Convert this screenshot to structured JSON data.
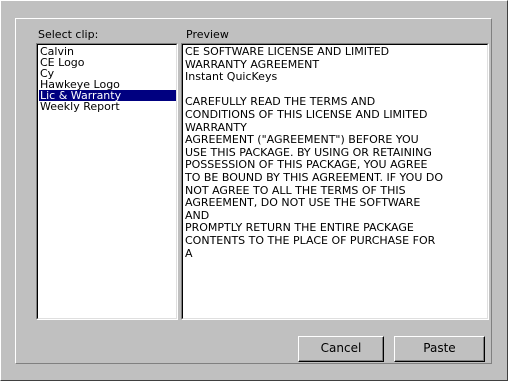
{
  "labels": {
    "select_clip": "Select clip:",
    "preview": "Preview"
  },
  "clips": {
    "items": [
      {
        "label": "Calvin"
      },
      {
        "label": "CE Logo"
      },
      {
        "label": "Cy"
      },
      {
        "label": "Hawkeye Logo"
      },
      {
        "label": "Lic & Warranty",
        "selected": true
      },
      {
        "label": "Weekly Report"
      }
    ],
    "selected": "Lic & Warranty"
  },
  "preview": {
    "text": "CE SOFTWARE LICENSE AND LIMITED\nWARRANTY AGREEMENT\nInstant QuicKeys\n\nCAREFULLY READ THE TERMS AND\nCONDITIONS OF THIS LICENSE AND LIMITED\nWARRANTY\nAGREEMENT (\"AGREEMENT\") BEFORE YOU\nUSE THIS PACKAGE. BY USING OR RETAINING\nPOSSESSION OF THIS PACKAGE, YOU AGREE\nTO BE BOUND BY THIS AGREEMENT. IF YOU DO\nNOT AGREE TO ALL THE TERMS OF THIS\nAGREEMENT, DO NOT USE THE SOFTWARE\nAND\nPROMPTLY RETURN THE ENTIRE PACKAGE\nCONTENTS TO THE PLACE OF PURCHASE FOR\nA"
  },
  "buttons": {
    "cancel": "Cancel",
    "paste": "Paste"
  },
  "colors": {
    "dialog_bg": "#c0c0c0",
    "selection_bg": "#000080",
    "selection_fg": "#ffffff"
  }
}
